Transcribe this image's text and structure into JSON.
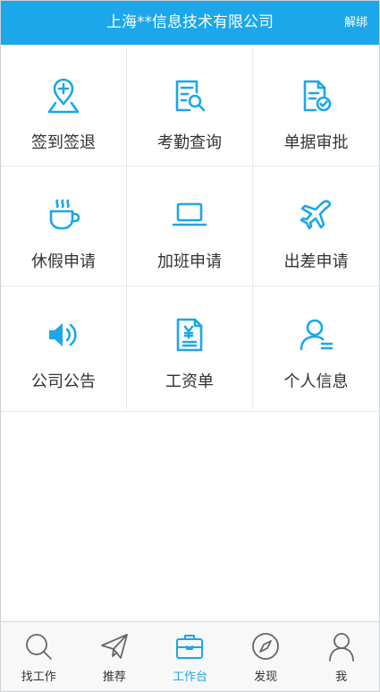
{
  "header": {
    "title": "上海**信息技术有限公司",
    "action_label": "解绑",
    "background_color": "#1ba7ea"
  },
  "menu": {
    "items": [
      {
        "label": "签到签退",
        "icon": "location-pin-icon"
      },
      {
        "label": "考勤查询",
        "icon": "document-search-icon"
      },
      {
        "label": "单据审批",
        "icon": "document-check-icon"
      },
      {
        "label": "休假申请",
        "icon": "coffee-cup-icon"
      },
      {
        "label": "加班申请",
        "icon": "laptop-icon"
      },
      {
        "label": "出差申请",
        "icon": "airplane-icon"
      },
      {
        "label": "公司公告",
        "icon": "speaker-icon"
      },
      {
        "label": "工资单",
        "icon": "payslip-icon"
      },
      {
        "label": "个人信息",
        "icon": "user-profile-icon"
      }
    ],
    "icon_color": "#1ba7ea"
  },
  "tabbar": {
    "tabs": [
      {
        "label": "找工作",
        "icon": "search-icon",
        "active": false
      },
      {
        "label": "推荐",
        "icon": "paper-plane-icon",
        "active": false
      },
      {
        "label": "工作台",
        "icon": "briefcase-icon",
        "active": true
      },
      {
        "label": "发现",
        "icon": "compass-icon",
        "active": false
      },
      {
        "label": "我",
        "icon": "person-icon",
        "active": false
      }
    ],
    "active_color": "#1ba7ea"
  }
}
